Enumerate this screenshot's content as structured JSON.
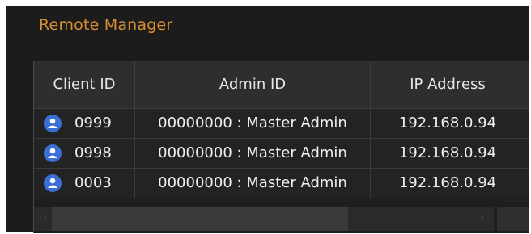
{
  "panel": {
    "title": "Remote Manager"
  },
  "table": {
    "columns": [
      "Client ID",
      "Admin ID",
      "IP Address"
    ],
    "rows": [
      {
        "client_id": "0999",
        "admin_id": "00000000 : Master Admin",
        "ip": "192.168.0.94",
        "icon": "user-icon"
      },
      {
        "client_id": "0998",
        "admin_id": "00000000 : Master Admin",
        "ip": "192.168.0.94",
        "icon": "user-icon"
      },
      {
        "client_id": "0003",
        "admin_id": "00000000 : Master Admin",
        "ip": "192.168.0.94",
        "icon": "user-icon"
      }
    ]
  },
  "scrollbar": {
    "left_arrow": "‹",
    "right_arrow": "›"
  },
  "colors": {
    "accent": "#d98e33",
    "background": "#1c1c1c",
    "icon": "#3b6fd6"
  }
}
